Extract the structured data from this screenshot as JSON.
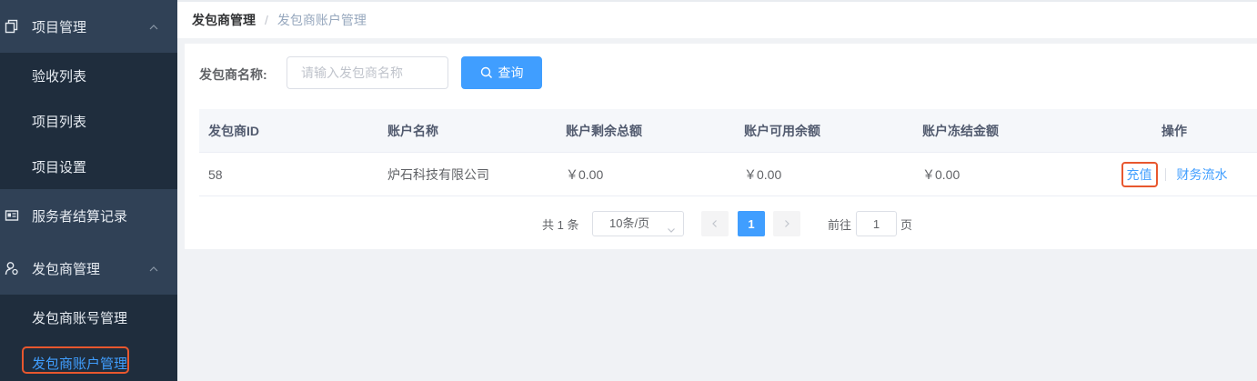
{
  "sidebar": {
    "groups": [
      {
        "label": "项目管理",
        "icon": "copy-icon",
        "expanded": true,
        "items": [
          "验收列表",
          "项目列表",
          "项目设置"
        ]
      },
      {
        "label": "服务者结算记录",
        "icon": "id-card-icon"
      },
      {
        "label": "发包商管理",
        "icon": "user-settings-icon",
        "expanded": true,
        "items": [
          "发包商账号管理",
          "发包商账户管理"
        ]
      }
    ],
    "active_item": "发包商账户管理"
  },
  "breadcrumb": {
    "first": "发包商管理",
    "separator": "/",
    "last": "发包商账户管理"
  },
  "search": {
    "label": "发包商名称:",
    "placeholder": "请输入发包商名称",
    "button_label": "查询"
  },
  "table": {
    "headers": [
      "发包商ID",
      "账户名称",
      "账户剩余总额",
      "账户可用余额",
      "账户冻结金额",
      "操作"
    ],
    "rows": [
      {
        "id": "58",
        "name": "炉石科技有限公司",
        "total": "￥0.00",
        "available": "￥0.00",
        "frozen": "￥0.00",
        "ops": [
          "充值",
          "财务流水"
        ]
      }
    ]
  },
  "pagination": {
    "total": "共 1 条",
    "page_size": "10条/页",
    "current_page": "1",
    "goto_label": "前往",
    "goto_value": "1",
    "page_suffix": "页"
  },
  "colors": {
    "primary": "#409eff",
    "sidebar_bg": "#304156",
    "highlight": "#e8572e"
  }
}
